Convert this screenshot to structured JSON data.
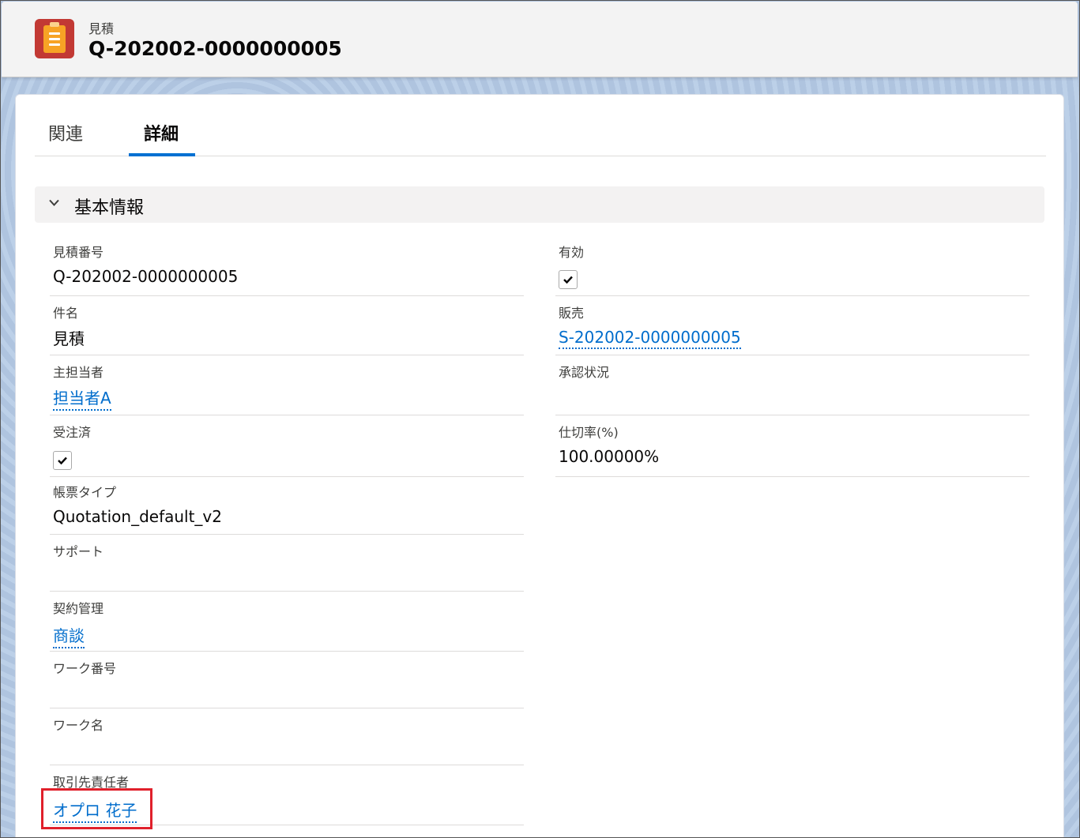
{
  "header": {
    "object_type": "見積",
    "record_title": "Q-202002-0000000005"
  },
  "tabs": [
    {
      "label": "関連",
      "active": false
    },
    {
      "label": "詳細",
      "active": true
    }
  ],
  "section": {
    "title": "基本情報"
  },
  "fields_left": [
    {
      "label": "見積番号",
      "value": "Q-202002-0000000005",
      "kind": "text"
    },
    {
      "label": "件名",
      "value": "見積",
      "kind": "text"
    },
    {
      "label": "主担当者",
      "value": "担当者A",
      "kind": "link"
    },
    {
      "label": "受注済",
      "checked": true,
      "kind": "checkbox"
    },
    {
      "label": "帳票タイプ",
      "value": "Quotation_default_v2",
      "kind": "text"
    },
    {
      "label": "サポート",
      "value": "",
      "kind": "text"
    },
    {
      "label": "契約管理",
      "value": "商談",
      "kind": "link"
    },
    {
      "label": "ワーク番号",
      "value": "",
      "kind": "text"
    },
    {
      "label": "ワーク名",
      "value": "",
      "kind": "text"
    },
    {
      "label": "取引先責任者",
      "value": "オプロ 花子",
      "kind": "link"
    }
  ],
  "fields_right": [
    {
      "label": "有効",
      "checked": true,
      "kind": "checkbox"
    },
    {
      "label": "販売",
      "value": "S-202002-0000000005",
      "kind": "link"
    },
    {
      "label": "承認状況",
      "value": "",
      "kind": "text"
    },
    {
      "label": "仕切率(%)",
      "value": "100.00000%",
      "kind": "text"
    }
  ],
  "colors": {
    "link": "#006dcc",
    "tab_active": "#0070d2",
    "highlight": "#e0202b",
    "icon_bg": "#c23934"
  },
  "icons": {
    "object_icon": "quote-icon",
    "section_toggle": "chevron-down-icon",
    "check": "check-icon"
  }
}
